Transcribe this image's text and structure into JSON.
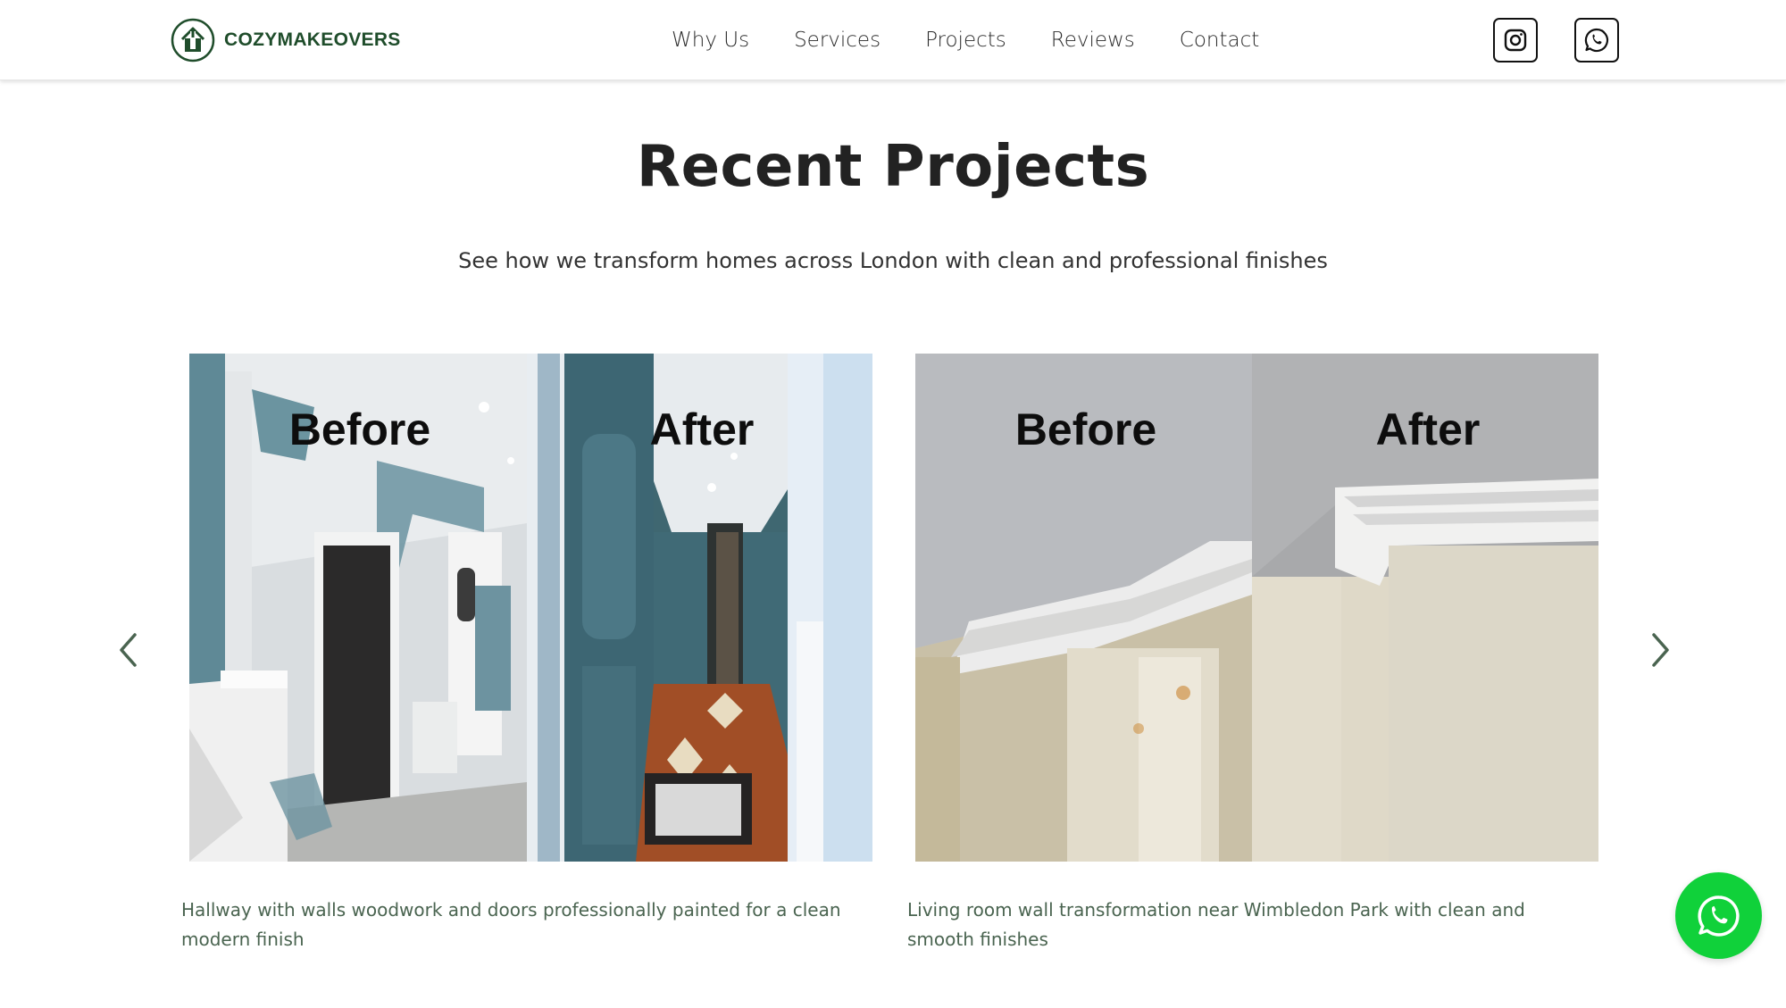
{
  "brand": {
    "name": "COZYMAKEOVERS",
    "color": "#1f4d2b"
  },
  "nav": {
    "items": [
      {
        "label": "Why Us"
      },
      {
        "label": "Services"
      },
      {
        "label": "Projects"
      },
      {
        "label": "Reviews"
      },
      {
        "label": "Contact"
      }
    ]
  },
  "social": {
    "icons": [
      "instagram-icon",
      "whatsapp-icon"
    ]
  },
  "section": {
    "title": "Recent Projects",
    "subtitle": "See how we transform homes across London with clean and professional finishes"
  },
  "projects": [
    {
      "before_label": "Before",
      "after_label": "After",
      "caption": "Hallway with walls woodwork and doors professionally painted for a clean modern finish"
    },
    {
      "before_label": "Before",
      "after_label": "After",
      "caption": "Living room wall transformation near Wimbledon Park with clean and smooth finishes"
    }
  ],
  "carousel": {
    "prev_icon": "chevron-left-icon",
    "next_icon": "chevron-right-icon"
  },
  "floating_button": {
    "icon": "whatsapp-icon",
    "color": "#10d13a"
  },
  "colors": {
    "caption": "#4a6450",
    "arrow": "#4a6450"
  }
}
